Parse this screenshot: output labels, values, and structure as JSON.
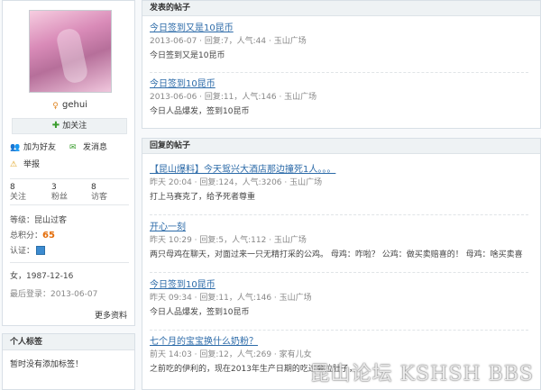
{
  "profile": {
    "username": "gehui",
    "follow_label": "加关注",
    "actions": {
      "add_friend": "加为好友",
      "send_message": "发消息",
      "report": "举报"
    },
    "stats": [
      {
        "num": "8",
        "label": "关注"
      },
      {
        "num": "3",
        "label": "粉丝"
      },
      {
        "num": "8",
        "label": "访客"
      }
    ],
    "level_label": "等级：",
    "level_value": "昆山过客",
    "points_label": "总积分：",
    "points_value": "65",
    "cert_label": "认证：",
    "bio": "女，1987-12-16",
    "last_login": "最后登录：2013-06-07",
    "more": "更多资料"
  },
  "tags": {
    "title": "个人标签",
    "empty": "暂时没有添加标签！"
  },
  "published": {
    "title": "发表的帖子",
    "posts": [
      {
        "title": "今日签到又是10昆币",
        "meta": "2013-06-07 · 回复:7，人气:44 · 玉山广场",
        "body": "今日签到又是10昆币"
      },
      {
        "title": "今日签到10昆币",
        "meta": "2013-06-06 · 回复:11，人气:146 · 玉山广场",
        "body": "今日人品爆发，签到10昆币"
      }
    ]
  },
  "replied": {
    "title": "回复的帖子",
    "posts": [
      {
        "title": "【昆山爆料】今天鸳兴大酒店那边撞死1人。。。",
        "meta": "昨天 20:04 · 回复:124，人气:3206 · 玉山广场",
        "body": "打上马赛克了，给予死者尊重"
      },
      {
        "title": "开心一刻",
        "meta": "昨天 10:29 · 回复:5，人气:112 · 玉山广场",
        "body": "两只母鸡在聊天，对面过来一只无精打采的公鸡。 母鸡：咋啦？ 公鸡：做买卖赔喜的！ 母鸡：啥买卖喜"
      },
      {
        "title": "今日签到10昆币",
        "meta": "昨天 09:34 · 回复:11，人气:146 · 玉山广场",
        "body": "今日人品爆发，签到10昆币"
      },
      {
        "title": "七个月的宝宝换什么奶粉？",
        "meta": "前天 14:03 · 回复:12，人气:269 · 家有儿女",
        "body": "之前吃的伊利的，现在2013年生产日期的吃过会拉肚子，"
      }
    ]
  },
  "watermark": "昆山论坛 KSHSH BBS"
}
